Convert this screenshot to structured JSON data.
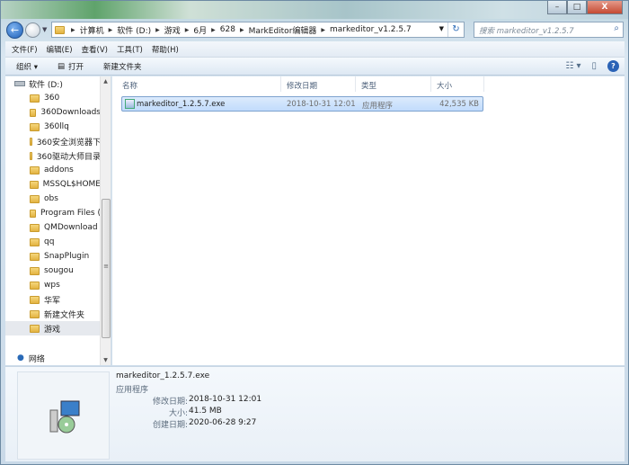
{
  "window": {
    "min": "–",
    "max": "□",
    "close": "X"
  },
  "address": {
    "crumbs": [
      "计算机",
      "软件 (D:)",
      "游戏",
      "6月",
      "628",
      "MarkEditor编辑器",
      "markeditor_v1.2.5.7"
    ]
  },
  "search": {
    "placeholder": "搜索 markeditor_v1.2.5.7"
  },
  "menu": [
    "文件(F)",
    "编辑(E)",
    "查看(V)",
    "工具(T)",
    "帮助(H)"
  ],
  "toolbar": {
    "organize": "组织 ▾",
    "open": "打开",
    "new_folder": "新建文件夹"
  },
  "nav": {
    "drive": "软件 (D:)",
    "folders": [
      "360",
      "360Downloads",
      "360llq",
      "360安全浏览器下",
      "360驱动大师目录",
      "addons",
      "MSSQL$HOME",
      "obs",
      "Program Files (",
      "QMDownload",
      "qq",
      "SnapPlugin",
      "sougou",
      "wps",
      "华军",
      "新建文件夹",
      "游戏"
    ],
    "network": "网络"
  },
  "columns": [
    "名称",
    "修改日期",
    "类型",
    "大小"
  ],
  "files": [
    {
      "name": "markeditor_1.2.5.7.exe",
      "modified": "2018-10-31 12:01",
      "type": "应用程序",
      "size": "42,535 KB"
    }
  ],
  "details": {
    "name": "markeditor_1.2.5.7.exe",
    "type": "应用程序",
    "modified_label": "修改日期:",
    "modified": "2018-10-31 12:01",
    "size_label": "大小:",
    "size": "41.5 MB",
    "created_label": "创建日期:",
    "created": "2020-06-28 9:27"
  }
}
